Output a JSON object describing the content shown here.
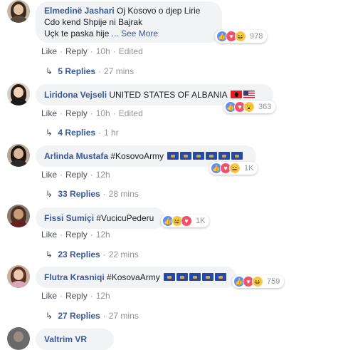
{
  "comments": [
    {
      "name": "Elmedinë Jashari",
      "text_lines": [
        "Oj Kosovo o djep Lirie",
        "Cdo kend Shpije ni Bajrak",
        "Uçk te paska hije"
      ],
      "see_more": "... See More",
      "actions": {
        "like": "Like",
        "reply": "Reply",
        "time": "10h",
        "edited": "Edited"
      },
      "reactions": {
        "icons": [
          "like-icon",
          "love-icon",
          "haha-icon"
        ],
        "count": "978"
      },
      "replies": {
        "label": "5 Replies",
        "time": "27 mins"
      }
    },
    {
      "name": "Liridona Vejseli",
      "text": "UNITED STATES OF ALBANIA",
      "flags": [
        "albania",
        "usa"
      ],
      "actions": {
        "like": "Like",
        "reply": "Reply",
        "time": "10h",
        "edited": "Edited"
      },
      "reactions": {
        "icons": [
          "like-icon",
          "love-icon",
          "wow-icon"
        ],
        "count": "363"
      },
      "replies": {
        "label": "4 Replies",
        "time": "1 hr"
      }
    },
    {
      "name": "Arlinda Mustafa",
      "text": "#KosovoArmy",
      "flags": [
        "kosovo",
        "kosovo",
        "kosovo",
        "kosovo",
        "kosovo",
        "kosovo"
      ],
      "actions": {
        "like": "Like",
        "reply": "Reply",
        "time": "12h"
      },
      "reactions": {
        "icons": [
          "like-icon",
          "love-icon",
          "haha-icon"
        ],
        "count": "1K"
      },
      "replies": {
        "label": "33 Replies",
        "time": "28 mins"
      }
    },
    {
      "name": "Fissi Sumiçi",
      "text": "#VucicuPederu",
      "actions": {
        "like": "Like",
        "reply": "Reply",
        "time": "12h"
      },
      "reactions": {
        "icons": [
          "like-icon",
          "haha-icon",
          "love-icon"
        ],
        "count": "1K"
      },
      "replies": {
        "label": "23 Replies",
        "time": "22 mins"
      }
    },
    {
      "name": "Flutra Krasniqi",
      "text": "#KosovaArmy",
      "flags": [
        "kosovo",
        "kosovo",
        "kosovo",
        "kosovo",
        "kosovo"
      ],
      "actions": {
        "like": "Like",
        "reply": "Reply",
        "time": "12h"
      },
      "reactions": {
        "icons": [
          "like-icon",
          "love-icon",
          "haha-icon"
        ],
        "count": "759"
      },
      "replies": {
        "label": "27 Replies",
        "time": "27 mins"
      }
    },
    {
      "name": "Valtrim VR"
    }
  ],
  "separators": {
    "dot": "·"
  }
}
